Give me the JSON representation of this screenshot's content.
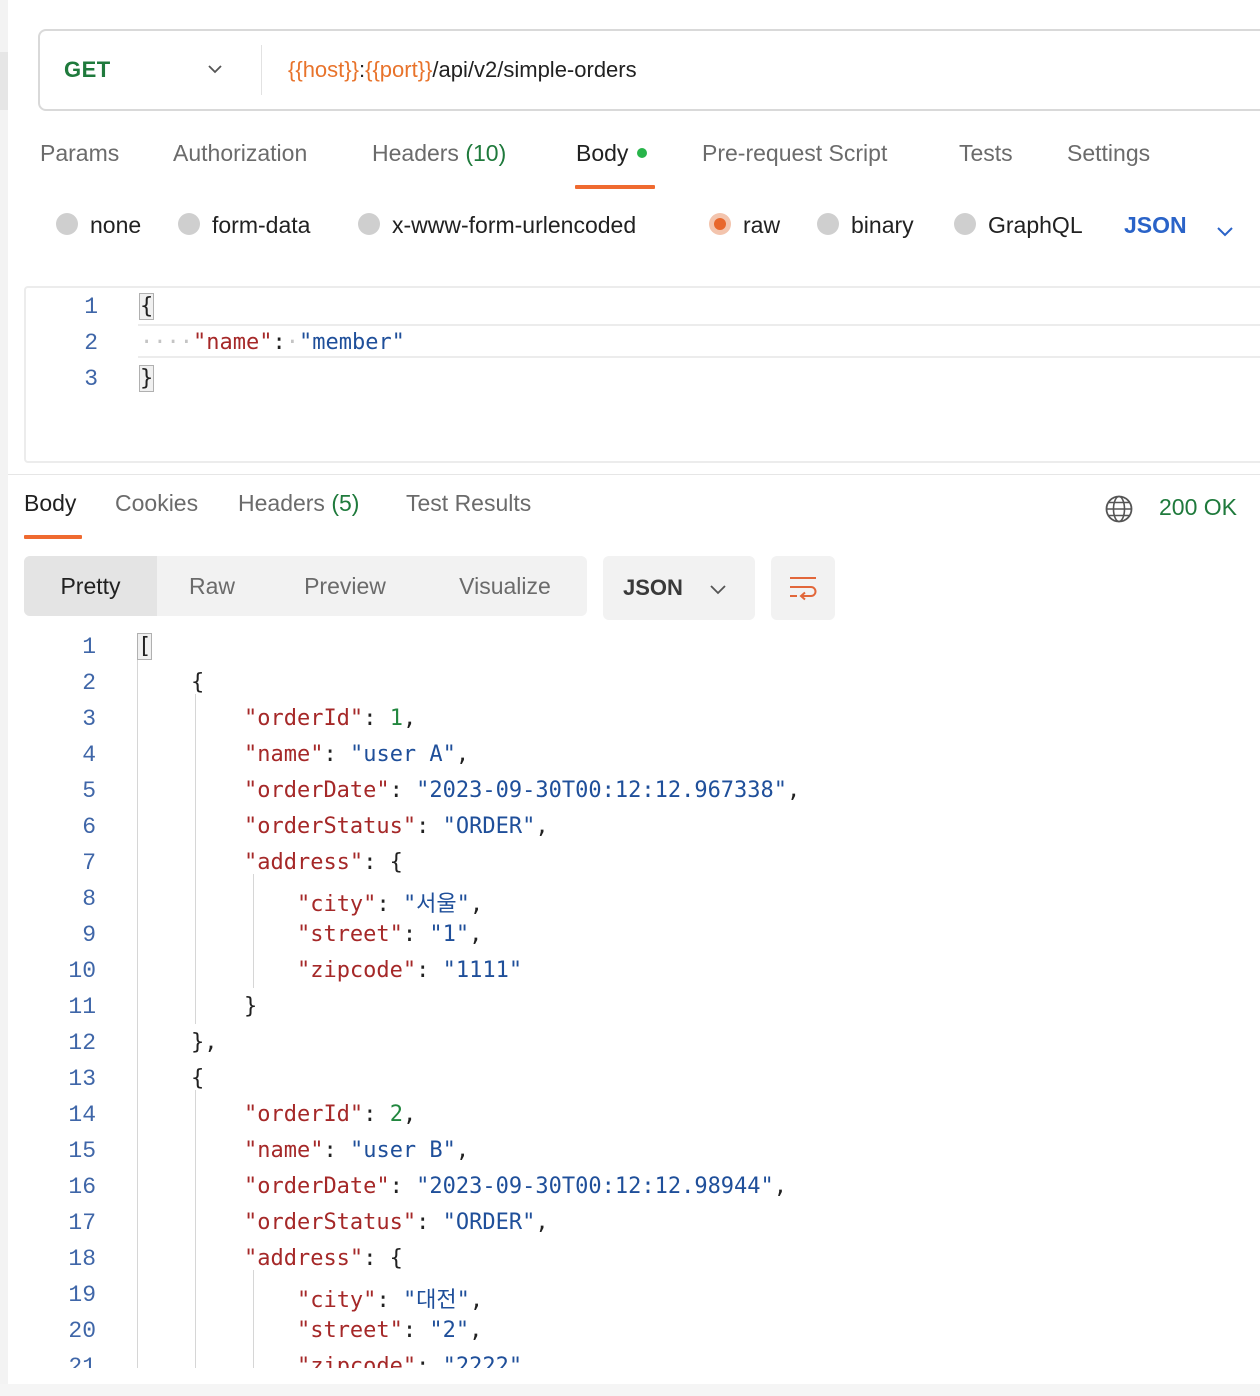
{
  "request": {
    "method": "GET",
    "url_parts": [
      {
        "text": "{{host}}",
        "type": "var"
      },
      {
        "text": ":",
        "type": "plain"
      },
      {
        "text": "{{port}}",
        "type": "var"
      },
      {
        "text": "/api/v2/simple-orders",
        "type": "plain"
      }
    ],
    "tabs": {
      "params": "Params",
      "authorization": "Authorization",
      "headers": "Headers",
      "headers_count": "(10)",
      "body": "Body",
      "prerequest": "Pre-request Script",
      "tests": "Tests",
      "settings": "Settings"
    },
    "body_types": {
      "none": "none",
      "form_data": "form-data",
      "urlencoded": "x-www-form-urlencoded",
      "raw": "raw",
      "binary": "binary",
      "graphql": "GraphQL",
      "selected": "raw"
    },
    "format": "JSON",
    "body_line_numbers": [
      "1",
      "2",
      "3"
    ]
  },
  "response": {
    "tabs": {
      "body": "Body",
      "cookies": "Cookies",
      "headers": "Headers",
      "headers_count": "(5)",
      "test_results": "Test Results"
    },
    "status": "200 OK",
    "views": {
      "pretty": "Pretty",
      "raw": "Raw",
      "preview": "Preview",
      "visualize": "Visualize"
    },
    "format": "JSON",
    "line_numbers": [
      "1",
      "2",
      "3",
      "4",
      "5",
      "6",
      "7",
      "8",
      "9",
      "10",
      "11",
      "12",
      "13",
      "14",
      "15",
      "16",
      "17",
      "18",
      "19",
      "20",
      "21"
    ]
  },
  "icons": {
    "method_dropdown": "chevron-down-icon",
    "format_dropdown": "chevron-down-icon",
    "network": "globe-icon",
    "wrap": "wrap-lines-icon"
  },
  "colors": {
    "accent": "#ef6a30",
    "method": "#1f7a3c",
    "variable": "#e8732b",
    "link": "#2a63c8",
    "status_ok": "#1f7a3c",
    "json_key": "#a52828",
    "json_string": "#1f4f9a",
    "json_number": "#22873f"
  }
}
